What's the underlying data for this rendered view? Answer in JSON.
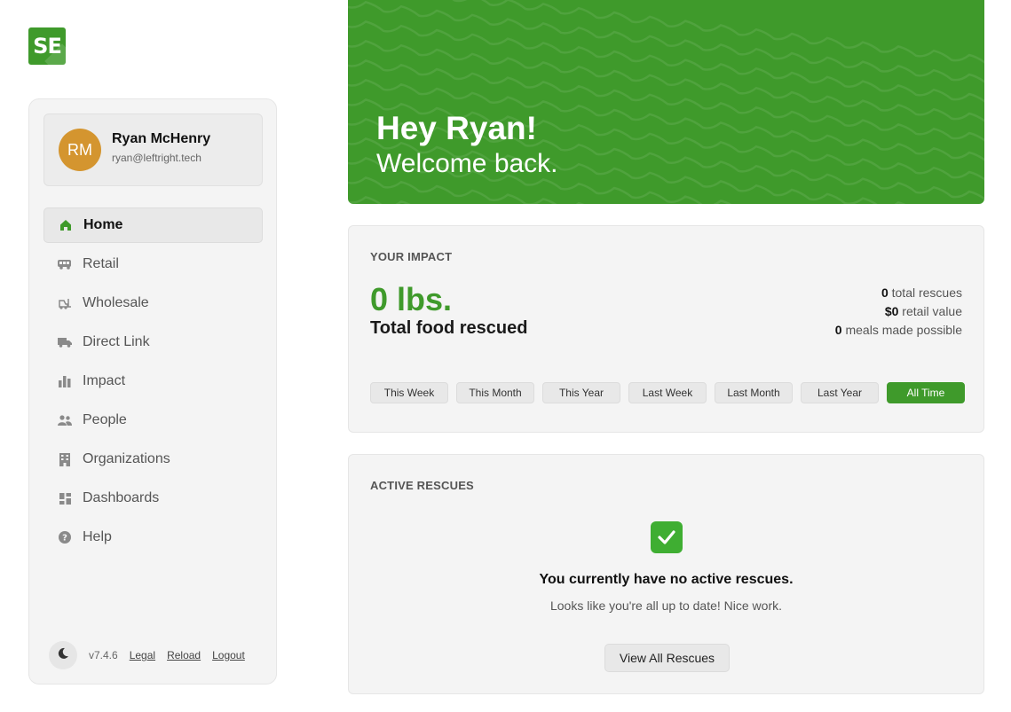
{
  "logo": {
    "text": "SE",
    "color": "#3f9a2b"
  },
  "user": {
    "initials": "RM",
    "name": "Ryan McHenry",
    "email": "ryan@leftright.tech",
    "avatar_color": "#d4952f"
  },
  "nav": {
    "items": [
      {
        "label": "Home",
        "icon": "home-icon",
        "active": true
      },
      {
        "label": "Retail",
        "icon": "van-icon"
      },
      {
        "label": "Wholesale",
        "icon": "forklift-icon"
      },
      {
        "label": "Direct Link",
        "icon": "truck-icon"
      },
      {
        "label": "Impact",
        "icon": "bar-chart-icon"
      },
      {
        "label": "People",
        "icon": "people-icon"
      },
      {
        "label": "Organizations",
        "icon": "building-icon"
      },
      {
        "label": "Dashboards",
        "icon": "dashboard-icon"
      },
      {
        "label": "Help",
        "icon": "help-icon"
      }
    ]
  },
  "footer": {
    "version": "v7.4.6",
    "legal": "Legal",
    "reload": "Reload",
    "logout": "Logout"
  },
  "banner": {
    "greeting": "Hey Ryan!",
    "subtitle": "Welcome back.",
    "color": "#3f9a2b"
  },
  "impact": {
    "title": "YOUR IMPACT",
    "amount": "0 lbs.",
    "amount_label": "Total food rescued",
    "stats": [
      {
        "value": "0",
        "label": "total rescues"
      },
      {
        "value": "$0",
        "label": "retail value"
      },
      {
        "value": "0",
        "label": "meals made possible"
      }
    ],
    "filters": [
      "This Week",
      "This Month",
      "This Year",
      "Last Week",
      "Last Month",
      "Last Year",
      "All Time"
    ],
    "active_filter": "All Time"
  },
  "active_rescues": {
    "title": "ACTIVE RESCUES",
    "empty_title": "You currently have no active rescues.",
    "empty_subtitle": "Looks like you're all up to date! Nice work.",
    "button": "View All Rescues"
  }
}
